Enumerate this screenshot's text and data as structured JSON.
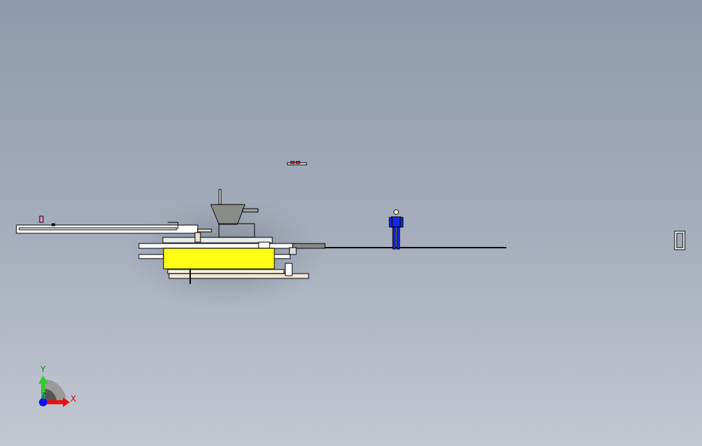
{
  "viewport": {
    "axis_triad": {
      "y_label": "Y",
      "z_label": "Z",
      "x_label": "X"
    }
  }
}
